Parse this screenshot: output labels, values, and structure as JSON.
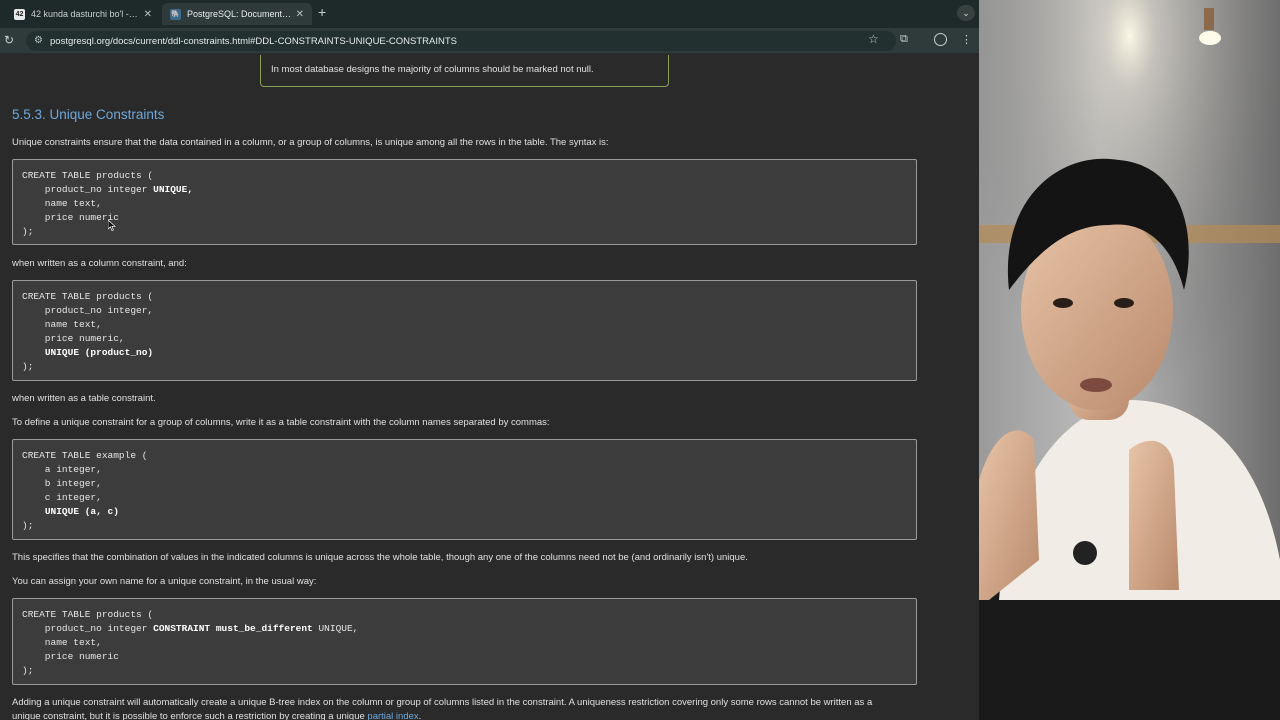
{
  "browser": {
    "tabs": [
      {
        "title": "42 kunda dasturchi bo'l - 42...",
        "favicon": "42"
      },
      {
        "title": "PostgreSQL: Documentation:",
        "favicon": "pg"
      }
    ],
    "url": "postgresql.org/docs/current/ddl-constraints.html#DDL-CONSTRAINTS-UNIQUE-CONSTRAINTS"
  },
  "doc": {
    "note": "In most database designs the majority of columns should be marked not null.",
    "heading": "5.5.3. Unique Constraints",
    "p1": "Unique constraints ensure that the data contained in a column, or a group of columns, is unique among all the rows in the table. The syntax is:",
    "code1": {
      "l1": "CREATE TABLE products (",
      "l2a": "    product_no integer ",
      "l2b": "UNIQUE,",
      "l3": "    name text,",
      "l4": "    price numeric",
      "l5": ");"
    },
    "p2": "when written as a column constraint, and:",
    "code2": {
      "l1": "CREATE TABLE products (",
      "l2": "    product_no integer,",
      "l3": "    name text,",
      "l4": "    price numeric,",
      "l5a": "    ",
      "l5b": "UNIQUE (product_no)",
      "l6": ");"
    },
    "p3": "when written as a table constraint.",
    "p4": "To define a unique constraint for a group of columns, write it as a table constraint with the column names separated by commas:",
    "code3": {
      "l1": "CREATE TABLE example (",
      "l2": "    a integer,",
      "l3": "    b integer,",
      "l4": "    c integer,",
      "l5a": "    ",
      "l5b": "UNIQUE (a, c)",
      "l6": ");"
    },
    "p5": "This specifies that the combination of values in the indicated columns is unique across the whole table, though any one of the columns need not be (and ordinarily isn't) unique.",
    "p6": "You can assign your own name for a unique constraint, in the usual way:",
    "code4": {
      "l1": "CREATE TABLE products (",
      "l2a": "    product_no integer ",
      "l2b": "CONSTRAINT must_be_different",
      "l2c": " UNIQUE,",
      "l3": "    name text,",
      "l4": "    price numeric",
      "l5": ");"
    },
    "p7": "Adding a unique constraint will automatically create a unique B-tree index on the column or group of columns listed in the constraint. A uniqueness restriction covering only some rows cannot be written as a",
    "p8a": "unique constraint, but it is possible to enforce such a restriction by creating a unique ",
    "p8link": "partial index",
    "p8b": "."
  },
  "colors": {
    "link": "#6fa8dc",
    "note_border": "#8aa15a",
    "code_bg": "#3c3c3c"
  }
}
